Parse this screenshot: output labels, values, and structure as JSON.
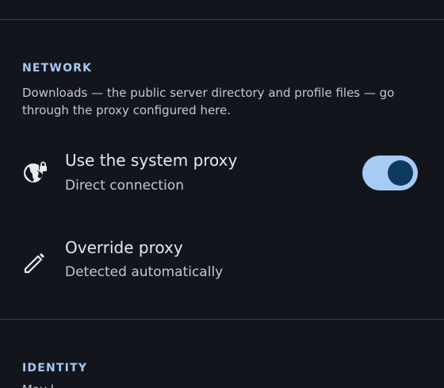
{
  "network": {
    "title": "NETWORK",
    "description_lines": [
      "Downloads — the public server directory and profile files — go",
      "through the proxy configured here."
    ],
    "settings": [
      {
        "icon": "globe-lock-icon",
        "title": "Use the system proxy",
        "subtitle": "Direct connection",
        "toggle": {
          "on": true
        }
      },
      {
        "icon": "pencil-icon",
        "title": "Override proxy",
        "subtitle": "Detected automatically"
      }
    ]
  },
  "identity": {
    "title": "IDENTITY",
    "description_partial": "May l… … … … … …  … … … … … …  … … … … … …  …  …… … … … … …  … … … … … …  … … … …"
  },
  "colors": {
    "background": "#12161c",
    "accent": "#a8c8f0",
    "toggle_track": "#a8cbf5",
    "toggle_thumb": "#0f3a5f",
    "divider": "#3a3f46"
  }
}
